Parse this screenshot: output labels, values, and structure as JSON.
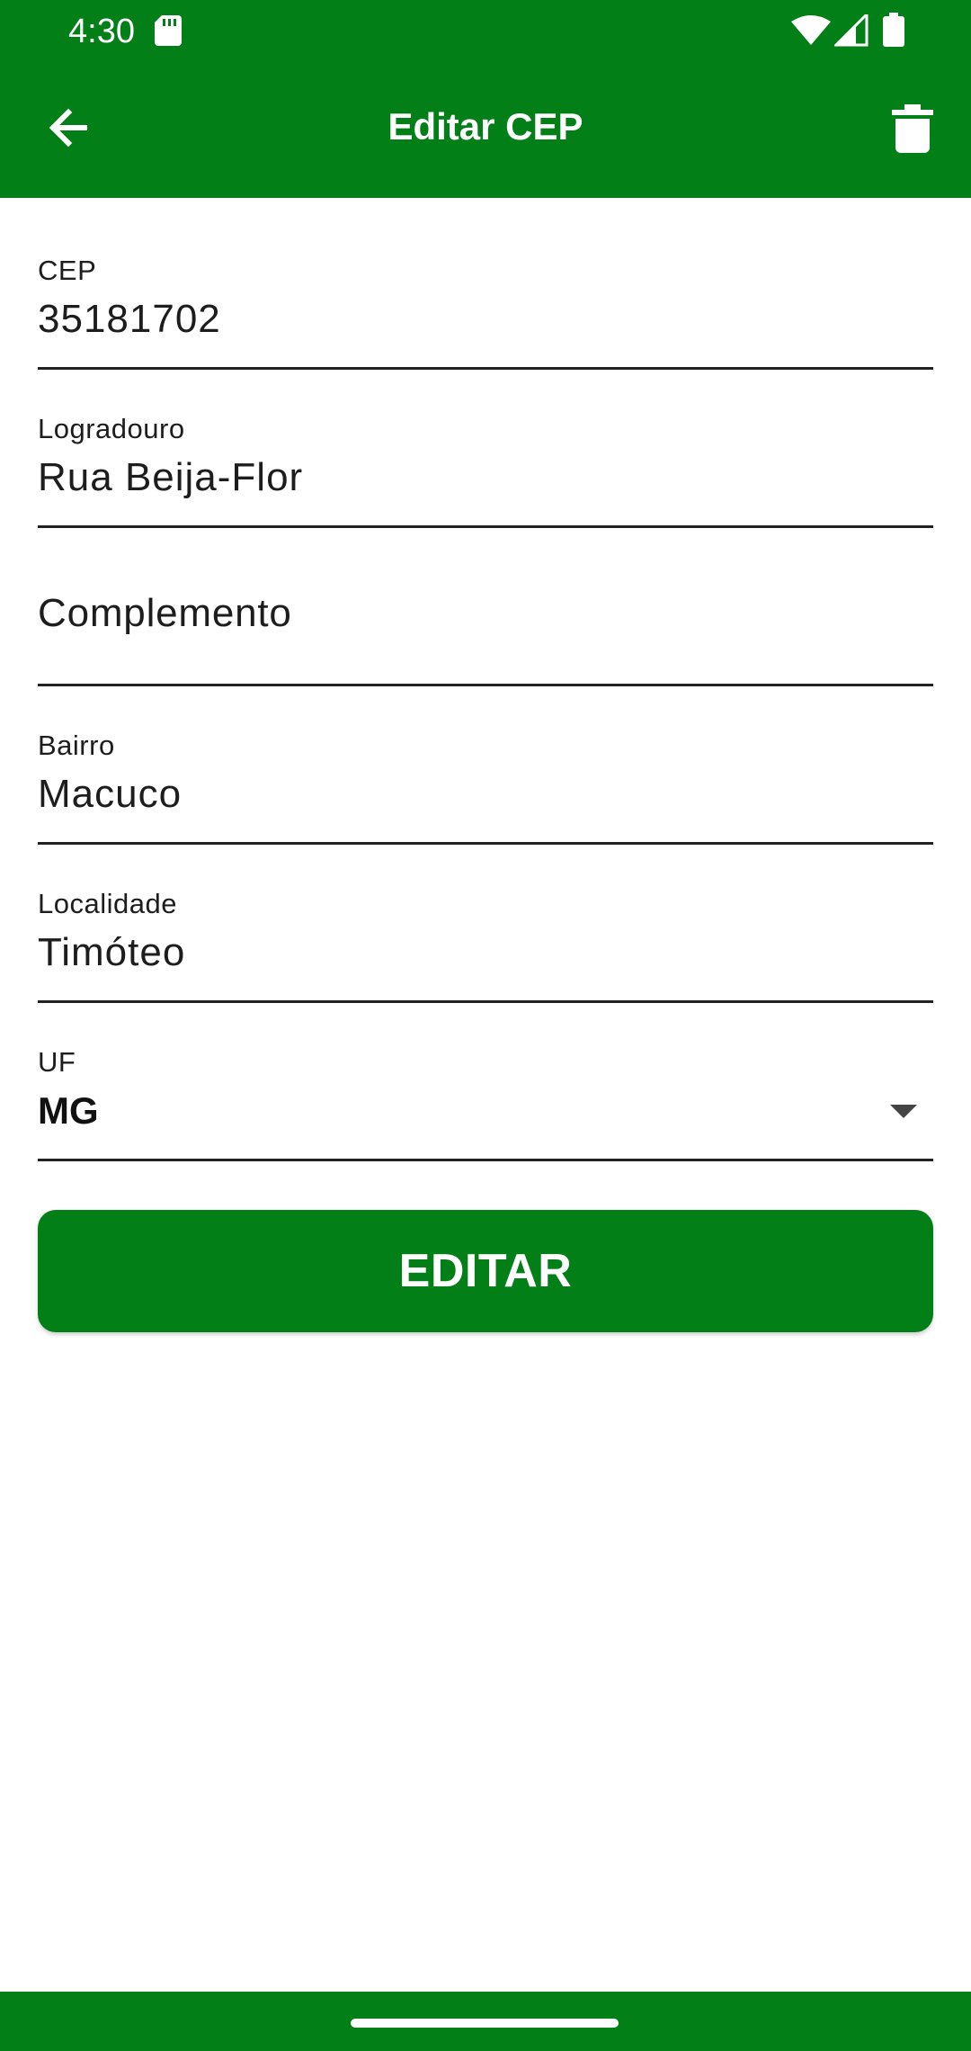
{
  "status_bar": {
    "time": "4:30"
  },
  "app_bar": {
    "title": "Editar CEP",
    "back_icon": "arrow-back-icon",
    "delete_icon": "trash-icon"
  },
  "form": {
    "cep": {
      "label": "CEP",
      "value": "35181702"
    },
    "logradouro": {
      "label": "Logradouro",
      "value": "Rua Beija-Flor"
    },
    "complemento": {
      "placeholder": "Complemento",
      "value": ""
    },
    "bairro": {
      "label": "Bairro",
      "value": "Macuco"
    },
    "localidade": {
      "label": "Localidade",
      "value": "Timóteo"
    },
    "uf": {
      "label": "UF",
      "selected": "MG"
    }
  },
  "actions": {
    "edit_label": "EDITAR"
  },
  "colors": {
    "primary": "#037f17",
    "on_primary": "#ffffff",
    "underline": "#222222"
  }
}
